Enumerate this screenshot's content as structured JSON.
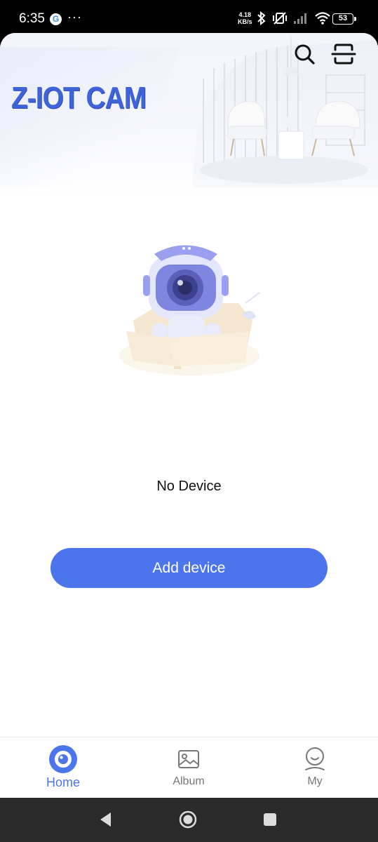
{
  "status_bar": {
    "time": "6:35",
    "google_badge": "G",
    "more_dots": "···",
    "net_speed_value": "4.18",
    "net_speed_unit": "KB/s",
    "battery": "53"
  },
  "header": {
    "app_name": "Z-IOT CAM"
  },
  "main": {
    "empty_message": "No Device",
    "add_button_label": "Add device"
  },
  "bottom_nav": {
    "items": [
      {
        "label": "Home",
        "active": true
      },
      {
        "label": "Album",
        "active": false
      },
      {
        "label": "My",
        "active": false
      }
    ]
  },
  "colors": {
    "accent": "#4c75ec",
    "logo": "#3f63d8"
  }
}
